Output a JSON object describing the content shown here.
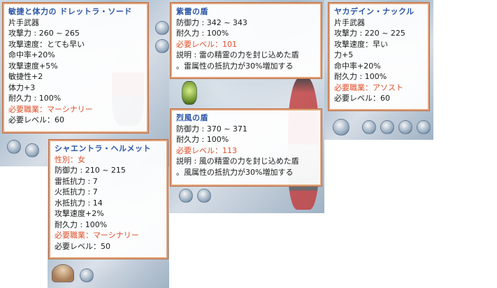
{
  "colors": {
    "title": "#2a55a6",
    "required": "#e0502a",
    "panel_border": "#e3a37a",
    "text": "#1a1a1a"
  },
  "tooltips": {
    "sword": {
      "title": "敏捷と体力の ドレットラ・ソード",
      "lines": [
        "片手武器",
        "攻撃力 : 260 ~ 265",
        "攻撃速度：とても早い",
        "命中率+20%",
        "攻撃速度+5%",
        "敏捷性+2",
        "体力+3",
        "耐久力 : 100%"
      ],
      "req_job": "必要職業：マーシナリー",
      "req_level": "必要レベル：60"
    },
    "helmet": {
      "title": "シャエントラ・ヘルメット",
      "sex": "性別：女",
      "lines": [
        "防御力 : 210 ~ 215",
        "雷抵抗力 : 7",
        "火抵抗力 : 7",
        "水抵抗力 : 14",
        "攻撃速度+2%",
        "耐久力 : 100%"
      ],
      "req_job": "必要職業：マーシナリー",
      "req_level": "必要レベル：50"
    },
    "thunder_shield": {
      "title": "紫雷の盾",
      "lines": [
        "防御力 : 342 ~ 343",
        "耐久力 : 100%"
      ],
      "req_level": "必要レベル：101",
      "desc1": "説明 : 雷の精霊の力を封じ込めた盾",
      "desc2": "。雷属性の抵抗力が30%増加する"
    },
    "wind_shield": {
      "title": "烈風の盾",
      "lines": [
        "防御力 : 370 ~ 371",
        "耐久力 : 100%"
      ],
      "req_level": "必要レベル：113",
      "desc1": "説明 : 風の精霊の力を封じ込めた盾",
      "desc2": "。風属性の抵抗力が30%増加する"
    },
    "knuckle": {
      "title": "ヤカデイン・ナックル",
      "lines": [
        "片手武器",
        "攻撃力 : 220 ~ 225",
        "攻撃速度：早い",
        "力+5",
        "命中率+20%",
        "耐久力 : 100%"
      ],
      "req_job": "必要職業：アソスト",
      "req_level": "必要レベル：60"
    }
  }
}
